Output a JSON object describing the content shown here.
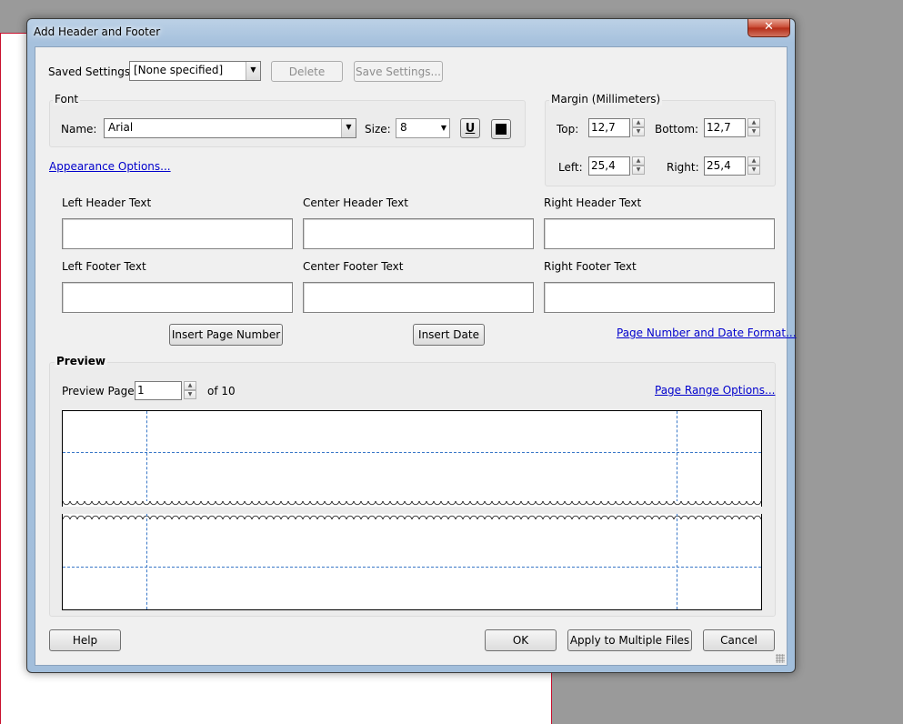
{
  "window": {
    "title": "Add Header and Footer",
    "close_label": "✕"
  },
  "saved_settings": {
    "label": "Saved Settings:",
    "value": "[None specified]",
    "delete_label": "Delete",
    "save_label": "Save Settings..."
  },
  "font": {
    "group_title": "Font",
    "name_label": "Name:",
    "name_value": "Arial",
    "size_label": "Size:",
    "size_value": "8",
    "underline_icon": "U"
  },
  "margin": {
    "group_title": "Margin (Millimeters)",
    "top_label": "Top:",
    "top_value": "12,7",
    "bottom_label": "Bottom:",
    "bottom_value": "12,7",
    "left_label": "Left:",
    "left_value": "25,4",
    "right_label": "Right:",
    "right_value": "25,4"
  },
  "appearance_link": "Appearance Options...",
  "text_fields": {
    "left_header": "Left Header Text",
    "center_header": "Center Header Text",
    "right_header": "Right Header Text",
    "left_footer": "Left Footer Text",
    "center_footer": "Center Footer Text",
    "right_footer": "Right Footer Text"
  },
  "insert": {
    "page_number": "Insert Page Number",
    "date": "Insert Date",
    "format_link": "Page Number and Date Format..."
  },
  "preview": {
    "group_title": "Preview",
    "page_label": "Preview Page",
    "page_value": "1",
    "of_text": "of 10",
    "range_link": "Page Range Options..."
  },
  "buttons": {
    "help": "Help",
    "ok": "OK",
    "apply_multiple": "Apply to Multiple Files",
    "cancel": "Cancel"
  },
  "colors": {
    "link": "#0000cc",
    "guide": "#3a78c8",
    "close": "#c7452f"
  }
}
